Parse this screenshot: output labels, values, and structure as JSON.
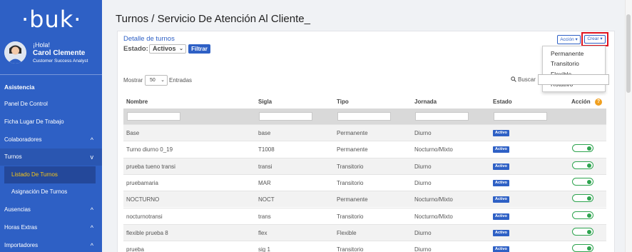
{
  "sidebar": {
    "logo": "·buk·",
    "greeting": "¡Hola!",
    "user_name": "Carol Clemente",
    "user_role": "Customer Success Analyst",
    "items": [
      {
        "label": "Asistencia"
      },
      {
        "label": "Panel De Control"
      },
      {
        "label": "Ficha Lugar De Trabajo"
      },
      {
        "label": "Colaboradores",
        "chevron": "^"
      },
      {
        "label": "Turnos",
        "chevron": "v"
      },
      {
        "label": "Listado De Turnos"
      },
      {
        "label": "Asignación De Turnos"
      },
      {
        "label": "Ausencias",
        "chevron": "^"
      },
      {
        "label": "Horas Extras",
        "chevron": "^"
      },
      {
        "label": "Importadores",
        "chevron": "^"
      }
    ]
  },
  "header": {
    "title": "Turnos / Servicio De Atención Al Cliente_"
  },
  "card": {
    "title": "Detalle de turnos",
    "estado_label": "Estado:",
    "estado_value": "Activos",
    "filter_button": "Filtrar",
    "accion_button": "Acción ▾",
    "crear_button": "Crear ▾"
  },
  "crear_menu": [
    "Permanente",
    "Transitorio",
    "Flexible",
    "Rotativo"
  ],
  "table_controls": {
    "show_label": "Mostrar",
    "page_size": "50",
    "entries_label": "Entradas",
    "search_label": "Buscar"
  },
  "table": {
    "headers": [
      "Nombre",
      "Sigla",
      "Tipo",
      "Jornada",
      "Estado",
      "Acción"
    ],
    "rows": [
      {
        "nombre": "Base",
        "sigla": "base",
        "tipo": "Permanente",
        "jornada": "Diurno",
        "estado": "Activo",
        "toggle": false
      },
      {
        "nombre": "Turno diurno 0_19",
        "sigla": "T1008",
        "tipo": "Permanente",
        "jornada": "Nocturno/Mixto",
        "estado": "Activo",
        "toggle": true
      },
      {
        "nombre": "prueba tueno transi",
        "sigla": "transi",
        "tipo": "Transitorio",
        "jornada": "Diurno",
        "estado": "Activo",
        "toggle": true
      },
      {
        "nombre": "pruebamaria",
        "sigla": "MAR",
        "tipo": "Transitorio",
        "jornada": "Diurno",
        "estado": "Activo",
        "toggle": true
      },
      {
        "nombre": "NOCTURNO",
        "sigla": "NOCT",
        "tipo": "Permanente",
        "jornada": "Nocturno/Mixto",
        "estado": "Activo",
        "toggle": true
      },
      {
        "nombre": "nocturnotransi",
        "sigla": "trans",
        "tipo": "Transitorio",
        "jornada": "Nocturno/Mixto",
        "estado": "Activo",
        "toggle": true
      },
      {
        "nombre": "flexible prueba 8",
        "sigla": "flex",
        "tipo": "Flexible",
        "jornada": "Diurno",
        "estado": "Activo",
        "toggle": true
      },
      {
        "nombre": "prueba",
        "sigla": "sig 1",
        "tipo": "Transitorio",
        "jornada": "Diurno",
        "estado": "Activo",
        "toggle": true
      }
    ]
  },
  "colors": {
    "sidebar": "#2e60c5",
    "accent": "#2e60c5",
    "highlight_box": "#e0121d",
    "toggle_on": "#2ea44f",
    "current_nav_text": "#f5c518"
  }
}
